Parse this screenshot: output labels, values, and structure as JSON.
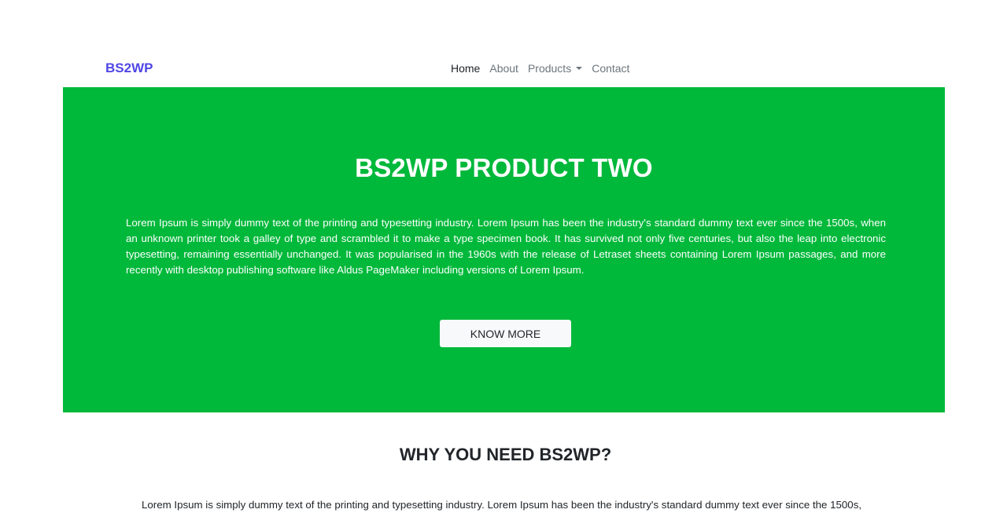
{
  "navbar": {
    "brand": "BS2WP",
    "links": [
      {
        "label": "Home",
        "active": true
      },
      {
        "label": "About"
      },
      {
        "label": "Products",
        "dropdown": true
      },
      {
        "label": "Contact"
      }
    ]
  },
  "hero": {
    "title": "BS2WP PRODUCT TWO",
    "text": "Lorem Ipsum is simply dummy text of the printing and typesetting industry. Lorem Ipsum has been the industry's standard dummy text ever since the 1500s, when an unknown printer took a galley of type and scrambled it to make a type specimen book. It has survived not only five centuries, but also the leap into electronic typesetting, remaining essentially unchanged. It was popularised in the 1960s with the release of Letraset sheets containing Lorem Ipsum passages, and more recently with desktop publishing software like Aldus PageMaker including versions of Lorem Ipsum.",
    "button_label": "KNOW MORE",
    "background_color": "#00b83a"
  },
  "section": {
    "title": "WHY YOU NEED BS2WP?",
    "text": "Lorem Ipsum is simply dummy text of the printing and typesetting industry. Lorem Ipsum has been the industry's standard dummy text ever since the 1500s,"
  },
  "colors": {
    "brand": "#4f46e5",
    "accent_green": "#00b83a"
  }
}
